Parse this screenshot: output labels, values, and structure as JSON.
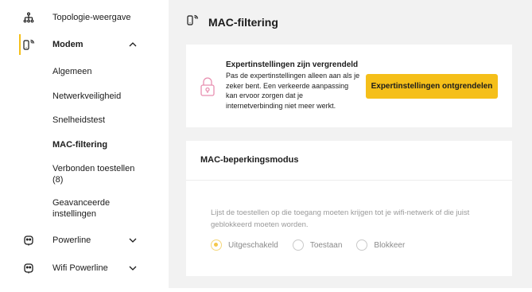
{
  "sidebar": {
    "items": [
      {
        "label": "Topologie-weergave",
        "icon": "topology-icon"
      },
      {
        "label": "Modem",
        "icon": "modem-icon",
        "expanded": true
      },
      {
        "label": "Powerline",
        "icon": "powerline-icon"
      },
      {
        "label": "Wifi Powerline",
        "icon": "wifi-powerline-icon"
      }
    ],
    "modem_sub": [
      {
        "label": "Algemeen"
      },
      {
        "label": "Netwerkveiligheid"
      },
      {
        "label": "Snelheidstest"
      },
      {
        "label": "MAC-filtering",
        "active": true
      },
      {
        "label": "Verbonden toestellen (8)"
      },
      {
        "label": "Geavanceerde instellingen"
      }
    ]
  },
  "main": {
    "title": "MAC-filtering",
    "lock_card": {
      "title": "Expertinstellingen zijn vergrendeld",
      "description": "Pas de expertinstellingen alleen aan als je zeker bent. Een verkeerde aanpassing kan ervoor zorgen dat je internetverbinding niet meer werkt.",
      "button": "Expertinstellingen ontgrendelen"
    },
    "mac_card": {
      "title": "MAC-beperkingsmodus",
      "description": "Lijst de toestellen op die toegang moeten krijgen tot je wifi-netwerk of die juist geblokkeerd moeten worden.",
      "options": [
        {
          "label": "Uitgeschakeld",
          "checked": true
        },
        {
          "label": "Toestaan",
          "checked": false
        },
        {
          "label": "Blokkeer",
          "checked": false
        }
      ]
    }
  },
  "colors": {
    "accent": "#f5bf19",
    "background": "#f2f2f2"
  }
}
